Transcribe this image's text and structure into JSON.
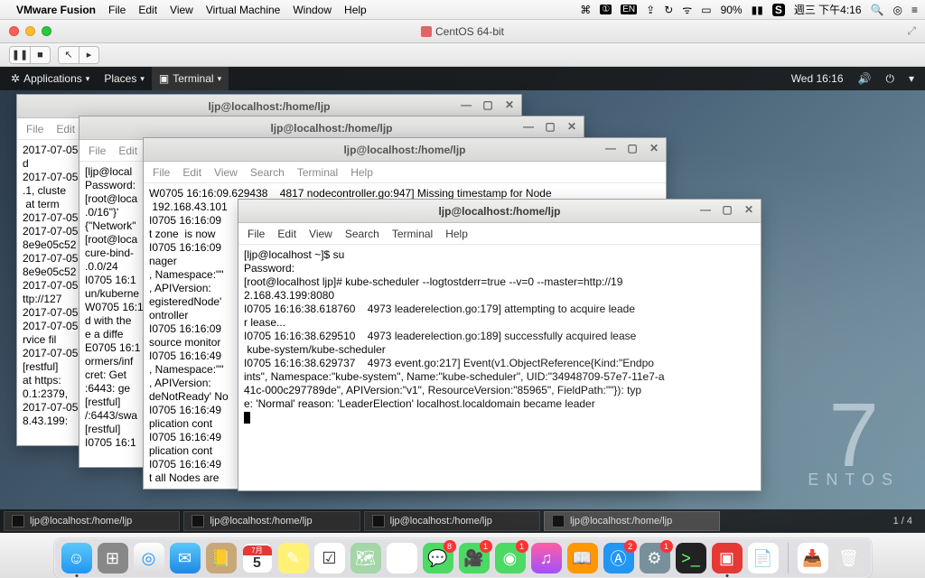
{
  "mac_menu": {
    "app": "VMware Fusion",
    "items": [
      "File",
      "Edit",
      "View",
      "Virtual Machine",
      "Window",
      "Help"
    ],
    "battery": "90%",
    "clock": "週三 下午4:16"
  },
  "vmw": {
    "title": "CentOS 64-bit"
  },
  "gnome_top": {
    "applications": "Applications",
    "places": "Places",
    "terminal": "Terminal",
    "clock": "Wed 16:16"
  },
  "centos_brand": {
    "digit": "7",
    "name": "ENTOS"
  },
  "windows": [
    {
      "title": "ljp@localhost:/home/ljp",
      "menu": [
        "File",
        "Edit"
      ],
      "body": "2017-07-05\nd\n2017-07-05\n.1, cluste\n at term \n2017-07-05\n2017-07-05\n8e9e05c52\n2017-07-05\n8e9e05c52\n2017-07-05\nttp://127\n2017-07-05\n2017-07-05\nrvice fil\n2017-07-05\n[restful]\nat https:\n0.1:2379,\n2017-07-05\n8.43.199:"
    },
    {
      "title": "ljp@localhost:/home/ljp",
      "menu": [
        "File",
        "Edit"
      ],
      "body": "[ljp@local\nPassword:\n[root@loca\n.0/16\"}'\n{\"Network\"\n[root@loca\ncure-bind-\n.0.0/24\nI0705 16:1\nun/kuberne\nW0705 16:1\nd with the\ne a diffe\nE0705 16:1\normers/inf\ncret: Get\n:6443: ge\n[restful]\n/:6443/swa\n[restful]\nI0705 16:1"
    },
    {
      "title": "ljp@localhost:/home/ljp",
      "menu": [
        "File",
        "Edit",
        "View",
        "Search",
        "Terminal",
        "Help"
      ],
      "body": "W0705 16:16:09.629438    4817 nodecontroller.go:947] Missing timestamp for Node\n 192.168.43.101\nI0705 16:16:09\nt zone  is now\nI0705 16:16:09\nnager\n, Namespace:\"\"\n, APIVersion:\negisteredNode'\nontroller\nI0705 16:16:09\nsource monitor\nI0705 16:16:49\n, Namespace:\"\"\n, APIVersion:\ndeNotReady' No\nI0705 16:16:49\nplication cont\nI0705 16:16:49\nplication cont\nI0705 16:16:49\nt all Nodes are"
    },
    {
      "title": "ljp@localhost:/home/ljp",
      "menu": [
        "File",
        "Edit",
        "View",
        "Search",
        "Terminal",
        "Help"
      ],
      "body": "[ljp@localhost ~]$ su\nPassword:\n[root@localhost ljp]# kube-scheduler --logtostderr=true --v=0 --master=http://19\n2.168.43.199:8080\nI0705 16:16:38.618760    4973 leaderelection.go:179] attempting to acquire leade\nr lease...\nI0705 16:16:38.629510    4973 leaderelection.go:189] successfully acquired lease\n kube-system/kube-scheduler\nI0705 16:16:38.629737    4973 event.go:217] Event(v1.ObjectReference{Kind:\"Endpo\nints\", Namespace:\"kube-system\", Name:\"kube-scheduler\", UID:\"34948709-57e7-11e7-a\n41c-000c297789de\", APIVersion:\"v1\", ResourceVersion:\"85965\", FieldPath:\"\"}): typ\ne: 'Normal' reason: 'LeaderElection' localhost.localdomain became leader"
    }
  ],
  "taskbar": {
    "items": [
      "ljp@localhost:/home/ljp",
      "ljp@localhost:/home/ljp",
      "ljp@localhost:/home/ljp",
      "ljp@localhost:/home/ljp"
    ],
    "workspace": "1 / 4"
  },
  "dock": {
    "cal_month": "7月",
    "cal_day": "5"
  }
}
